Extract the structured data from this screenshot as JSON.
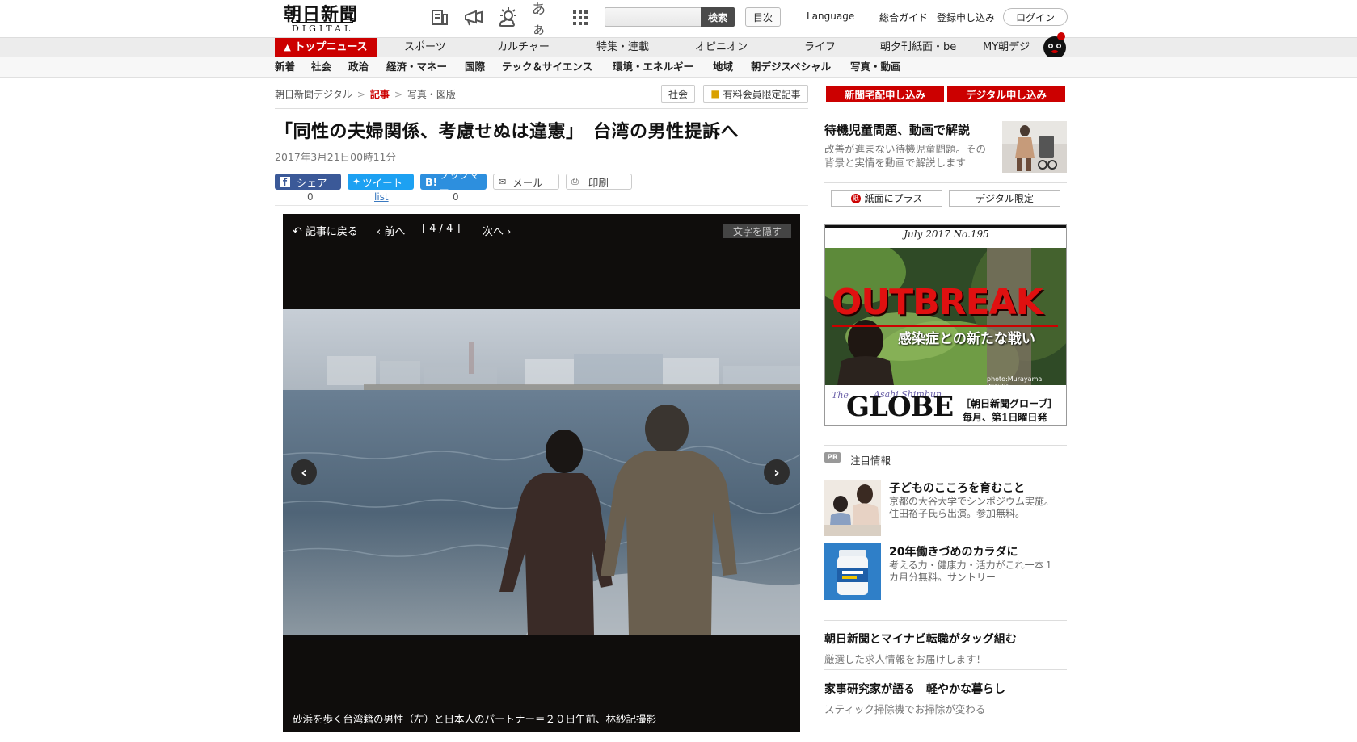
{
  "header": {
    "logo_main": "朝日新聞",
    "logo_sub": "DIGITAL",
    "icons": [
      "newspaper-icon",
      "megaphone-icon",
      "weather-icon",
      "font-size-icon",
      "grid-icon"
    ],
    "font_icon_text": "あぁ",
    "search_button": "検索",
    "contents_button": "目次",
    "language": "Language",
    "guide": "総合ガイド",
    "register": "登録申し込み",
    "login": "ログイン"
  },
  "nav": {
    "main": [
      "トップニュース",
      "スポーツ",
      "カルチャー",
      "特集・連載",
      "オピニオン",
      "ライフ",
      "朝夕刊紙面・be",
      "MY朝デジ"
    ],
    "sub": [
      "新着",
      "社会",
      "政治",
      "経済・マネー",
      "国際",
      "テック＆サイエンス",
      "環境・エネルギー",
      "地域",
      "朝デジスペシャル",
      "写真・動画"
    ]
  },
  "breadcrumb": {
    "items": [
      "朝日新聞デジタル",
      "記事",
      "写真・図版"
    ],
    "sep": ">"
  },
  "tags": {
    "category": "社会",
    "premium": "有料会員限定記事"
  },
  "article": {
    "headline": "「同性の夫婦関係、考慮せぬは違憲」　台湾の男性提訴へ",
    "date": "2017年3月21日00時11分"
  },
  "share": {
    "facebook": "シェア",
    "facebook_count": "0",
    "twitter": "ツイート",
    "twitter_count": "list",
    "hatena": "ブックマー",
    "hatena_count": "0",
    "mail": "メール",
    "print": "印刷"
  },
  "viewer": {
    "back": "記事に戻る",
    "prev": "前へ",
    "counter": "[ 4 / 4 ]",
    "next": "次へ",
    "hide_text": "文字を隠す",
    "caption": "砂浜を歩く台湾籍の男性（左）と日本人のパートナー＝２０日午前、林紗記撮影"
  },
  "sidebar": {
    "subscribe_paper": "新聞宅配申し込み",
    "subscribe_digital": "デジタル申し込み",
    "promo_title": "待機児童問題、動画で解説",
    "promo_desc": "改善が進まない待機児童問題。その背景と実情を動画で解説します",
    "tab_paper": "紙面にプラス",
    "tab_digital": "デジタル限定",
    "tab_paper_badge": "紙",
    "ad": {
      "date": "July 2017  No.195",
      "headline": "OUTBREAK",
      "subhead": "感染症との新たな戦い",
      "credit": "photo:Murayama Yusuke",
      "brand_the": "The",
      "brand_asahi": "Asahi Shimbun",
      "brand": "GLOBE",
      "note1": "［朝日新聞グローブ］",
      "note2": "毎月、第1日曜日発行。"
    },
    "pr_badge": "PR",
    "pr_title": "注目情報",
    "pr_items": [
      {
        "title": "子どものこころを育むこと",
        "desc": "京都の大谷大学でシンポジウム実施。住田裕子氏ら出演。参加無料。"
      },
      {
        "title": "20年働きづめのカラダに",
        "desc": "考える力・健康力・活力がこれ一本１カ月分無料。サントリー"
      }
    ],
    "links": [
      {
        "title": "朝日新聞とマイナビ転職がタッグ組む",
        "desc": "厳選した求人情報をお届けします！"
      },
      {
        "title": "家事研究家が語る　軽やかな暮らし",
        "desc": "スティック掃除機でお掃除が変わる"
      }
    ]
  },
  "colors": {
    "brand_red": "#cc0000",
    "facebook": "#3b5998",
    "twitter": "#1da1f2",
    "hatena": "#2d8fde",
    "viewer_bg": "#0f0d0c"
  }
}
